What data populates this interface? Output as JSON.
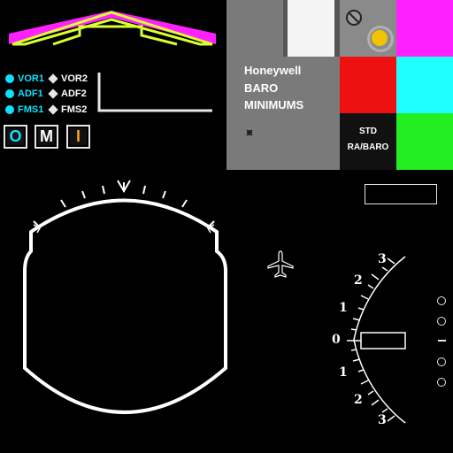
{
  "nav_sources": [
    {
      "left": "VOR1",
      "right": "VOR2"
    },
    {
      "left": "ADF1",
      "right": "ADF2"
    },
    {
      "left": "FMS1",
      "right": "FMS2"
    }
  ],
  "marker_beacons": [
    {
      "label": "O",
      "color": "#10e0ff"
    },
    {
      "label": "M",
      "color": "#ffffff"
    },
    {
      "label": "I",
      "color": "#f0a020"
    }
  ],
  "minimums_panel": {
    "brand": "Honeywell",
    "line1": "BARO",
    "line2": "MINIMUMS",
    "std_line1": "STD",
    "std_line2": "RA/BARO"
  },
  "glideslope_scale": {
    "upper": [
      "3",
      "2",
      "1"
    ],
    "center": "0",
    "lower": [
      "1",
      "2",
      "3"
    ]
  },
  "colors": {
    "magenta": "#ff20ff",
    "yellow_green": "#d8ff30",
    "red": "#ee1111",
    "cyan": "#20ffff",
    "green": "#22ee22",
    "gray_panel": "#7a7a7a"
  }
}
